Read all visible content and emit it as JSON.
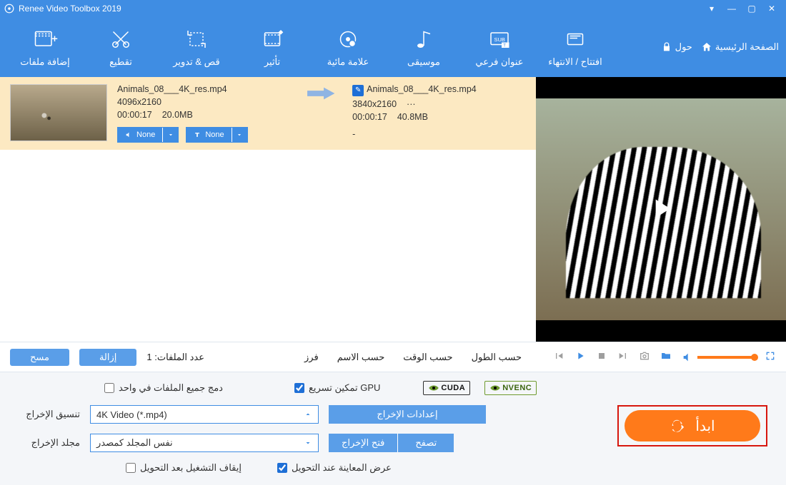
{
  "title": "Renee Video Toolbox 2019",
  "tools": {
    "add": "إضافة ملفات",
    "cut": "تقطيع",
    "crop": "قص & تدوير",
    "effect": "تأثير",
    "watermark": "علامة مائية",
    "music": "موسيقى",
    "subtitle": "عنوان فرعي",
    "intro": "افتتاح / الانتهاء"
  },
  "rightlinks": {
    "about": "حول",
    "home": "الصفحة الرئيسية"
  },
  "file": {
    "in_name": "Animals_08___4K_res.mp4",
    "in_res": "4096x2160",
    "in_dur": "00:00:17",
    "in_size": "20.0MB",
    "out_name": "Animals_08___4K_res.mp4",
    "out_res": "3840x2160",
    "out_more": "···",
    "out_dur": "00:00:17",
    "out_size": "40.8MB",
    "dd_audio": "None",
    "dd_sub": "None",
    "dash": "-"
  },
  "mid": {
    "clear": "مسح",
    "remove": "إزالة",
    "count_label": "عدد الملفات: 1",
    "sort_label": "فرز",
    "by_name": "حسب الاسم",
    "by_time": "حسب الوقت",
    "by_len": "حسب الطول"
  },
  "opts": {
    "merge": "دمج جميع الملفات في واحد",
    "gpu": "تمكين تسريع GPU",
    "cuda": "CUDA",
    "nvenc": "NVENC",
    "out_format_label": "تنسيق الإخراج",
    "out_format_value": "4K Video (*.mp4)",
    "out_settings": "إعدادات الإخراج",
    "out_folder_label": "مجلد الإخراج",
    "out_folder_value": "نفس المجلد كمصدر",
    "open_output": "فتح الإخراج",
    "browse": "تصفح",
    "preview_cb": "عرض المعاينة عند التحويل",
    "shutdown_cb": "إيقاف التشغيل بعد التحويل",
    "start": "ابدأ"
  }
}
